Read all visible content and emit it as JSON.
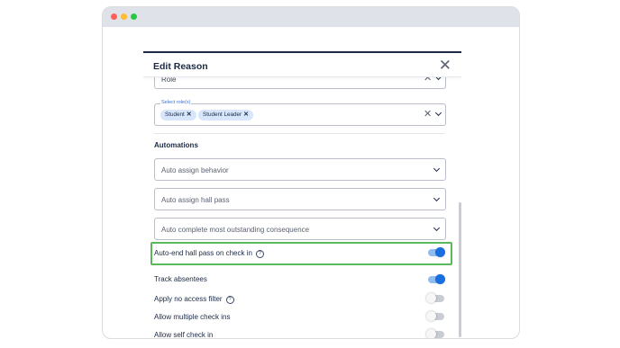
{
  "modal": {
    "title": "Edit Reason",
    "role_field_value": "Role",
    "roles_field_label": "Select role(s)",
    "role_chips": [
      "Student",
      "Student Leader"
    ],
    "automations_title": "Automations",
    "selects": [
      {
        "label": "Auto assign behavior"
      },
      {
        "label": "Auto assign hall pass"
      },
      {
        "label": "Auto complete most outstanding consequence"
      }
    ],
    "toggles": [
      {
        "label": "Auto-end hall pass on check in",
        "on": true,
        "help": true
      },
      {
        "label": "Track absentees",
        "on": true,
        "help": false
      },
      {
        "label": "Apply no access filter",
        "on": false,
        "help": true
      },
      {
        "label": "Allow multiple check ins",
        "on": false,
        "help": false
      },
      {
        "label": "Allow self check in",
        "on": false,
        "help": false
      }
    ]
  },
  "colors": {
    "accent": "#1a6fe0",
    "highlight_border": "#5cb85c",
    "title_text": "#1c2a44"
  }
}
